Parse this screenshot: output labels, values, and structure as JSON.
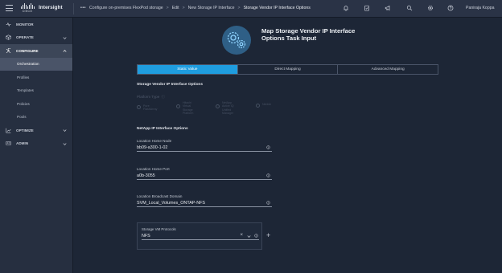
{
  "app": {
    "brand": "Intersight",
    "logo_text": "CISCO"
  },
  "breadcrumb": {
    "ellipsis": "•••",
    "separator": ">",
    "items": [
      "Configure on-premises FlexPod storage",
      "Edit",
      "New Storage IP Interface",
      "Storage Vendor IP Interface Options"
    ]
  },
  "topbar": {
    "icons": [
      "bell-icon",
      "clipboard-check-icon",
      "megaphone-icon",
      "search-icon",
      "gear-icon",
      "help-icon"
    ],
    "user": "Paniraja Koppa"
  },
  "sidebar": {
    "items": [
      {
        "label": "MONITOR",
        "icon": "monitor-icon",
        "expandable": false
      },
      {
        "label": "OPERATE",
        "icon": "operate-icon",
        "expandable": true
      },
      {
        "label": "CONFIGURE",
        "icon": "configure-icon",
        "expandable": true,
        "active": true
      }
    ],
    "configure_sub": [
      "Orchestration",
      "Profiles",
      "Templates",
      "Policies",
      "Pools"
    ],
    "active_sub": "Orchestration",
    "bottom_items": [
      {
        "label": "OPTIMIZE",
        "icon": "optimize-icon",
        "expandable": true
      },
      {
        "label": "ADMIN",
        "icon": "admin-icon",
        "expandable": true
      }
    ]
  },
  "page": {
    "title_line1": "Map Storage Vendor IP Interface",
    "title_line2": "Options Task Input"
  },
  "tabs": [
    "Static Value",
    "Direct Mapping",
    "Advanced Mapping"
  ],
  "active_tab": "Static Value",
  "sections": {
    "vendor": "Storage Vendor IP Interface Options",
    "netapp": "NetApp IP Interface Options"
  },
  "platform": {
    "label": "Platform Type",
    "options": [
      [
        "Pure",
        "FlashArray"
      ],
      [
        "Hitachi",
        "Virtual",
        "Storage",
        "Platform"
      ],
      [
        "NetApp",
        "Active IQ",
        "Unified",
        "Manager"
      ],
      [
        "Nimble"
      ]
    ]
  },
  "fields": {
    "home_node": {
      "label": "Location Home Node",
      "value": "bb09-a300-1-02"
    },
    "home_port": {
      "label": "Location Home Port",
      "value": "a0b-3055"
    },
    "broadcast": {
      "label": "Location Broadcast Domain",
      "value": "SVM_Local_Volumes_ONTAP-NFS"
    }
  },
  "protocols": {
    "label": "Storage VM Protocols",
    "value": "NFS",
    "clear": "×",
    "add": "+"
  },
  "colors": {
    "accent": "#1f9ddf",
    "background": "#1d2636",
    "sidebar": "#262f40",
    "topbar": "#2a3346"
  }
}
